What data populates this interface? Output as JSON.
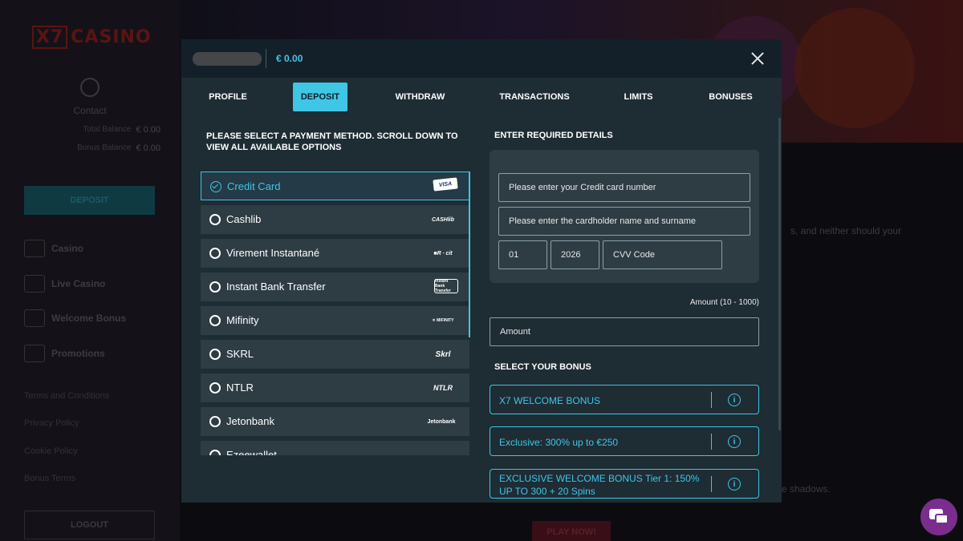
{
  "sidebar": {
    "logo": "X7 CASINO",
    "contact": "Contact",
    "total_balance_label": "Total Balance",
    "total_balance_value": "€ 0.00",
    "bonus_balance_label": "Bonus Balance",
    "bonus_balance_value": "€ 0.00",
    "deposit": "DEPOSIT",
    "nav": [
      "Casino",
      "Live Casino",
      "Welcome Bonus",
      "Promotions"
    ],
    "links": [
      "Terms and Conditions",
      "Privacy Policy",
      "Cookie Policy",
      "Bonus Terms"
    ],
    "logout": "LOGOUT"
  },
  "background": {
    "text1": "s, and neither should your",
    "text2": "e shadows.",
    "play_now": "PLAY NOW!"
  },
  "modal": {
    "balance": "€ 0.00",
    "tabs": [
      "PROFILE",
      "DEPOSIT",
      "WITHDRAW",
      "TRANSACTIONS",
      "LIMITS",
      "BONUSES"
    ],
    "active_tab": "DEPOSIT",
    "payment_title": "PLEASE SELECT A PAYMENT METHOD. SCROLL DOWN TO VIEW ALL AVAILABLE OPTIONS",
    "details_title": "ENTER REQUIRED DETAILS",
    "payment_methods": [
      {
        "label": "Credit Card",
        "logo": "VISA",
        "selected": true
      },
      {
        "label": "Cashlib",
        "logo": "CASHlib",
        "selected": false
      },
      {
        "label": "Virement Instantané",
        "logo": "■R ∙ cit",
        "selected": false
      },
      {
        "label": "Instant Bank Transfer",
        "logo": "Instant Bank Transfer",
        "selected": false
      },
      {
        "label": "Mifinity",
        "logo": "✕ MIFINITY",
        "selected": false
      },
      {
        "label": "SKRL",
        "logo": "Skrl",
        "selected": false
      },
      {
        "label": "NTLR",
        "logo": "NTLR",
        "selected": false
      },
      {
        "label": "Jetonbank",
        "logo": "Jetonbank",
        "selected": false
      },
      {
        "label": "Ezeewallet",
        "logo": "",
        "selected": false
      }
    ],
    "card_number_placeholder": "Please enter your Credit card number",
    "cardholder_placeholder": "Please enter the cardholder name and surname",
    "month_value": "01",
    "year_value": "2026",
    "cvv_placeholder": "CVV Code",
    "amount_note": "Amount (10 - 1000)",
    "amount_placeholder": "Amount",
    "bonus_title": "SELECT YOUR BONUS",
    "bonuses": [
      "X7 WELCOME BONUS",
      "Exclusive: 300% up to €250",
      "EXCLUSIVE WELCOME BONUS Tier 1: 150% UP TO 300 + 20 Spins"
    ]
  },
  "colors": {
    "accent": "#3fc6e6",
    "modal_bg": "#1e2c34",
    "header_bg": "#13202a",
    "item_bg": "#2e3c44"
  }
}
